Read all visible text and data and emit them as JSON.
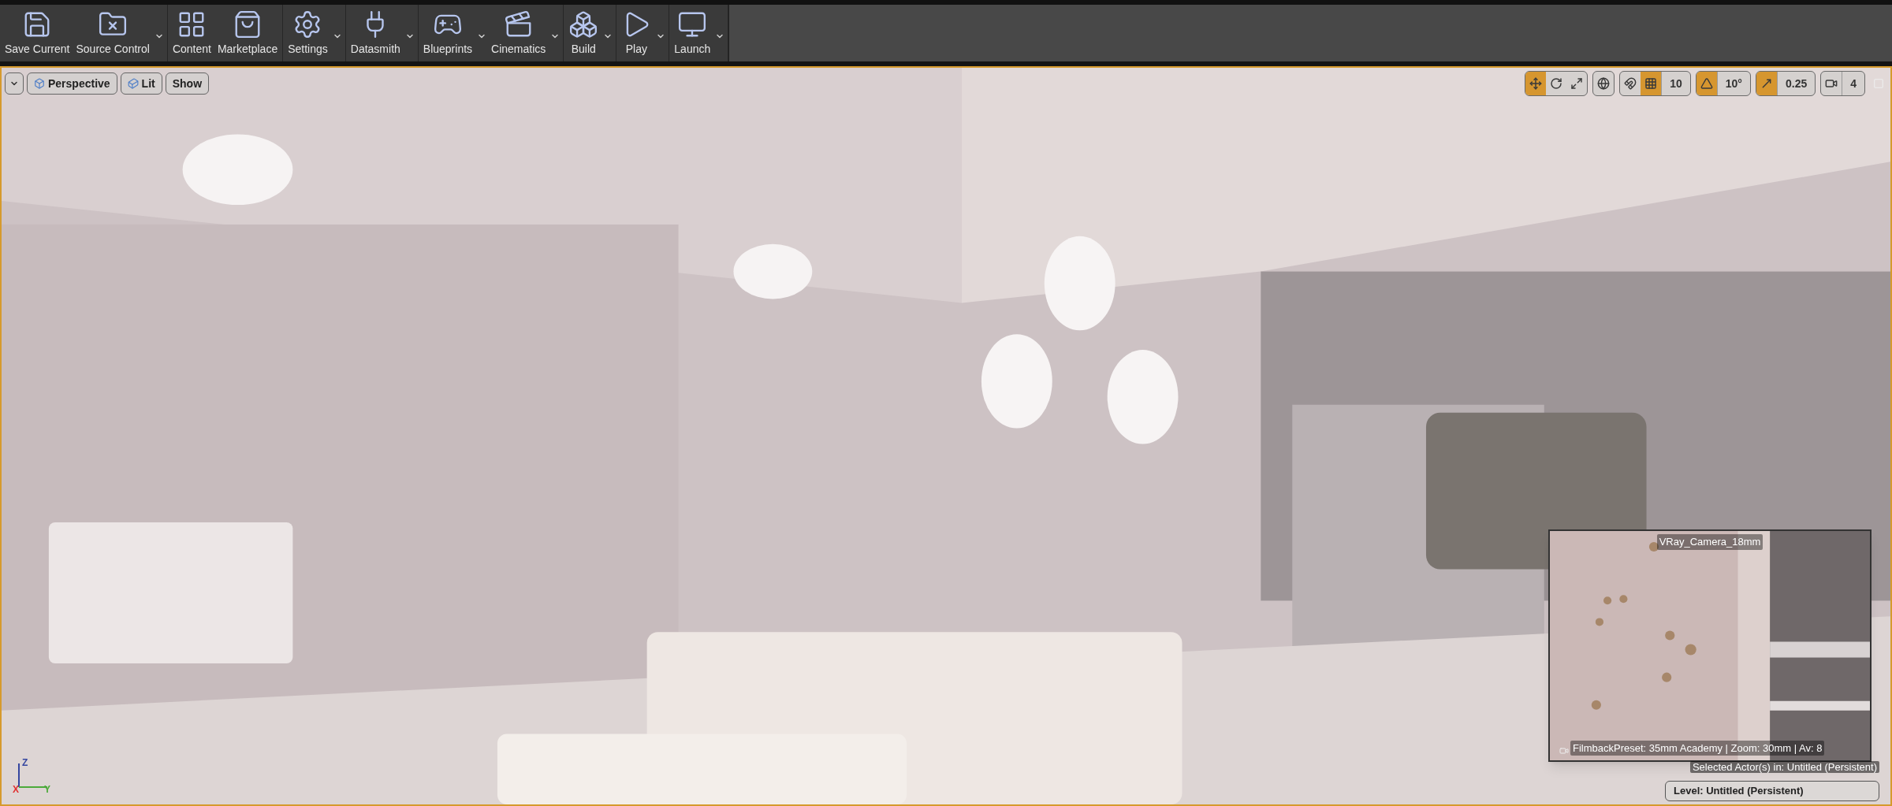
{
  "toolbar": {
    "groups": [
      {
        "items": [
          {
            "label": "Save Current",
            "dropdown": false
          },
          {
            "label": "Source Control",
            "dropdown": true
          }
        ]
      },
      {
        "items": [
          {
            "label": "Content",
            "dropdown": false
          },
          {
            "label": "Marketplace",
            "dropdown": false
          }
        ]
      },
      {
        "items": [
          {
            "label": "Settings",
            "dropdown": true
          }
        ]
      },
      {
        "items": [
          {
            "label": "Datasmith",
            "dropdown": true
          }
        ]
      },
      {
        "items": [
          {
            "label": "Blueprints",
            "dropdown": true
          },
          {
            "label": "Cinematics",
            "dropdown": true
          }
        ]
      },
      {
        "items": [
          {
            "label": "Build",
            "dropdown": true
          }
        ]
      },
      {
        "items": [
          {
            "label": "Play",
            "dropdown": true
          }
        ]
      },
      {
        "items": [
          {
            "label": "Launch",
            "dropdown": true
          }
        ]
      }
    ]
  },
  "viewport": {
    "left_buttons": [
      {
        "label": "Perspective"
      },
      {
        "label": "Lit"
      },
      {
        "label": "Show"
      }
    ],
    "snap_groups": [
      {
        "buttons": [
          {
            "selected": true
          },
          {
            "selected": false
          },
          {
            "selected": false
          }
        ]
      },
      {
        "buttons": [
          {
            "selected": false
          }
        ]
      },
      {
        "buttons": [
          {
            "selected": false
          },
          {
            "selected": true
          }
        ],
        "value": "10"
      },
      {
        "buttons": [
          {
            "selected": true
          }
        ],
        "value": "10°"
      },
      {
        "buttons": [
          {
            "selected": true
          }
        ],
        "value": "0.25"
      },
      {
        "buttons": [
          {
            "selected": false
          }
        ],
        "value": "4"
      }
    ],
    "axes": {
      "z": "Z",
      "x": "X",
      "y": "Y"
    },
    "camera_preview": {
      "title": "VRay_Camera_18mm",
      "info": "FilmbackPreset: 35mm Academy | Zoom: 30mm | Av: 8"
    },
    "selected_actors": "Selected Actor(s) in:  Untitled (Persistent)",
    "level": "Level:  Untitled (Persistent)"
  }
}
